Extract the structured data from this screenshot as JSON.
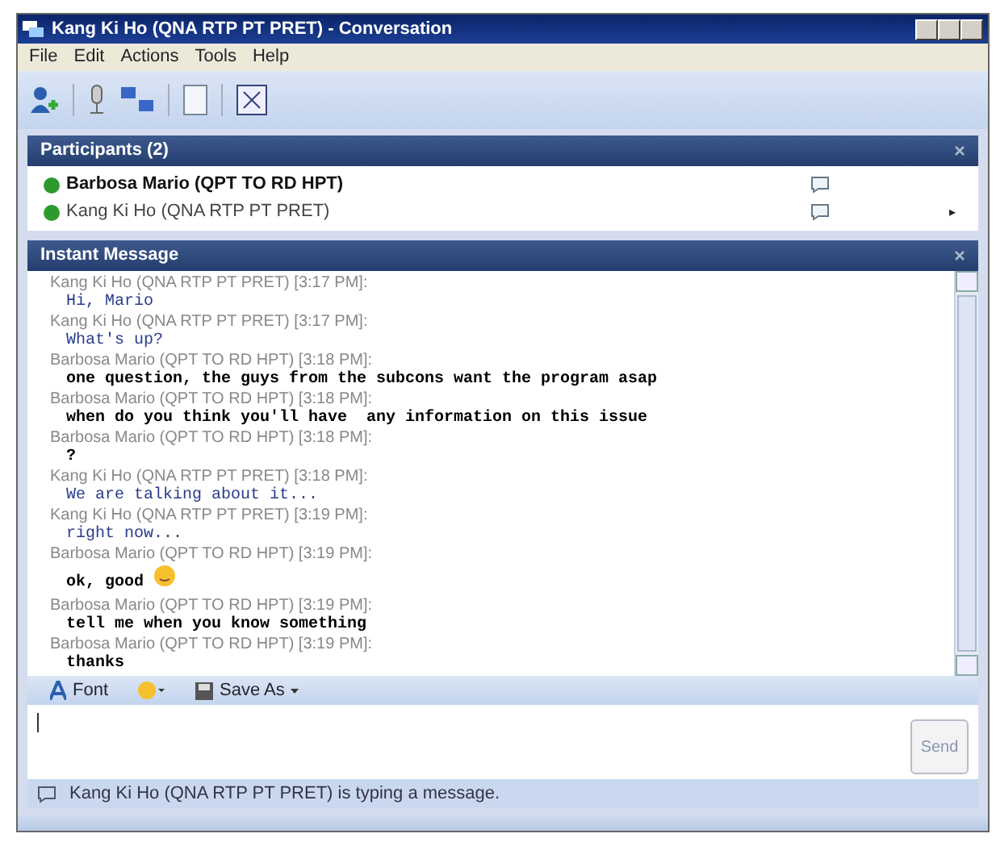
{
  "window": {
    "title": "Kang Ki Ho (QNA RTP PT PRET) - Conversation"
  },
  "menu": [
    "File",
    "Edit",
    "Actions",
    "Tools",
    "Help"
  ],
  "participants": {
    "title": "Participants (2)",
    "items": [
      {
        "name": "Barbosa Mario (QPT TO RD HPT)",
        "kind": "self",
        "color": "#2e9a2e"
      },
      {
        "name": "Kang Ki Ho (QNA RTP PT PRET)",
        "kind": "other",
        "color": "#2e9a2e",
        "arrow": "▸"
      }
    ]
  },
  "instant_message": {
    "title": "Instant Message",
    "messages": [
      {
        "sender": "Kang Ki Ho (QNA RTP PT PRET) [3:17 PM]:",
        "text": "Hi, Mario",
        "kind": "remote"
      },
      {
        "sender": "Kang Ki Ho (QNA RTP PT PRET) [3:17 PM]:",
        "text": "What's up?",
        "kind": "remote"
      },
      {
        "sender": "Barbosa Mario (QPT TO RD HPT) [3:18 PM]:",
        "text": "one question, the guys from the subcons want the program asap",
        "kind": "local"
      },
      {
        "sender": "Barbosa Mario (QPT TO RD HPT) [3:18 PM]:",
        "text": "when do you think you'll have  any information on this issue",
        "kind": "local"
      },
      {
        "sender": "Barbosa Mario (QPT TO RD HPT) [3:18 PM]:",
        "text": "?",
        "kind": "local"
      },
      {
        "sender": "Kang Ki Ho (QNA RTP PT PRET) [3:18 PM]:",
        "text": "We are talking about it...",
        "kind": "remote"
      },
      {
        "sender": "Kang Ki Ho (QNA RTP PT PRET) [3:19 PM]:",
        "text": "right now...",
        "kind": "remote"
      },
      {
        "sender": "Barbosa Mario (QPT TO RD HPT) [3:19 PM]:",
        "text": "ok, good",
        "kind": "local",
        "emoticon": true
      },
      {
        "sender": "Barbosa Mario (QPT TO RD HPT) [3:19 PM]:",
        "text": "tell me when you know something",
        "kind": "local"
      },
      {
        "sender": "Barbosa Mario (QPT TO RD HPT) [3:19 PM]:",
        "text": "thanks",
        "kind": "local"
      }
    ]
  },
  "format_bar": {
    "font": "Font",
    "save_as": "Save As"
  },
  "compose": {
    "send": "Send"
  },
  "status_bar": "Kang Ki Ho (QNA RTP PT PRET) is typing a message."
}
